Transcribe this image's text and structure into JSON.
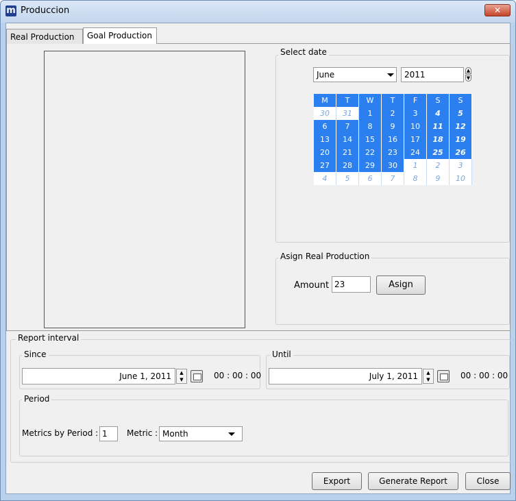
{
  "window": {
    "title": "Produccion",
    "app_icon": "m",
    "close_label": "✕"
  },
  "tabs": [
    {
      "label": "Real Production"
    },
    {
      "label": "Goal Production"
    }
  ],
  "select_date": {
    "legend": "Select date",
    "month": "June",
    "year": "2011",
    "weekday_headers": [
      "M",
      "T",
      "W",
      "T",
      "F",
      "S",
      "S"
    ],
    "weeks": [
      [
        "30",
        "31",
        "1",
        "2",
        "3",
        "4",
        "5"
      ],
      [
        "6",
        "7",
        "8",
        "9",
        "10",
        "11",
        "12"
      ],
      [
        "13",
        "14",
        "15",
        "16",
        "17",
        "18",
        "19"
      ],
      [
        "20",
        "21",
        "22",
        "23",
        "24",
        "25",
        "26"
      ],
      [
        "27",
        "28",
        "29",
        "30",
        "1",
        "2",
        "3"
      ],
      [
        "4",
        "5",
        "6",
        "7",
        "8",
        "9",
        "10"
      ]
    ],
    "out_of_month": [
      [
        0,
        0
      ],
      [
        0,
        1
      ],
      [
        4,
        4
      ],
      [
        4,
        5
      ],
      [
        4,
        6
      ],
      [
        5,
        0
      ],
      [
        5,
        1
      ],
      [
        5,
        2
      ],
      [
        5,
        3
      ],
      [
        5,
        4
      ],
      [
        5,
        5
      ],
      [
        5,
        6
      ]
    ],
    "colors": {
      "in_month": "#2b7fee",
      "out_month_text": "#7aa6de"
    }
  },
  "assign": {
    "legend": "Asign Real Production",
    "amount_label": "Amount",
    "amount_value": "23",
    "button": "Asign"
  },
  "report": {
    "legend": "Report interval",
    "since": {
      "legend": "Since",
      "date": "June 1, 2011",
      "time": "00 : 00 : 00"
    },
    "until": {
      "legend": "Until",
      "date": "July 1, 2011",
      "time": "00 : 00 : 00"
    },
    "period": {
      "legend": "Period",
      "metrics_label": "Metrics by Period :",
      "metrics_value": "1",
      "metric_label": "Metric :",
      "metric_value": "Month"
    }
  },
  "actions": {
    "export": "Export",
    "generate": "Generate Report",
    "close": "Close"
  }
}
